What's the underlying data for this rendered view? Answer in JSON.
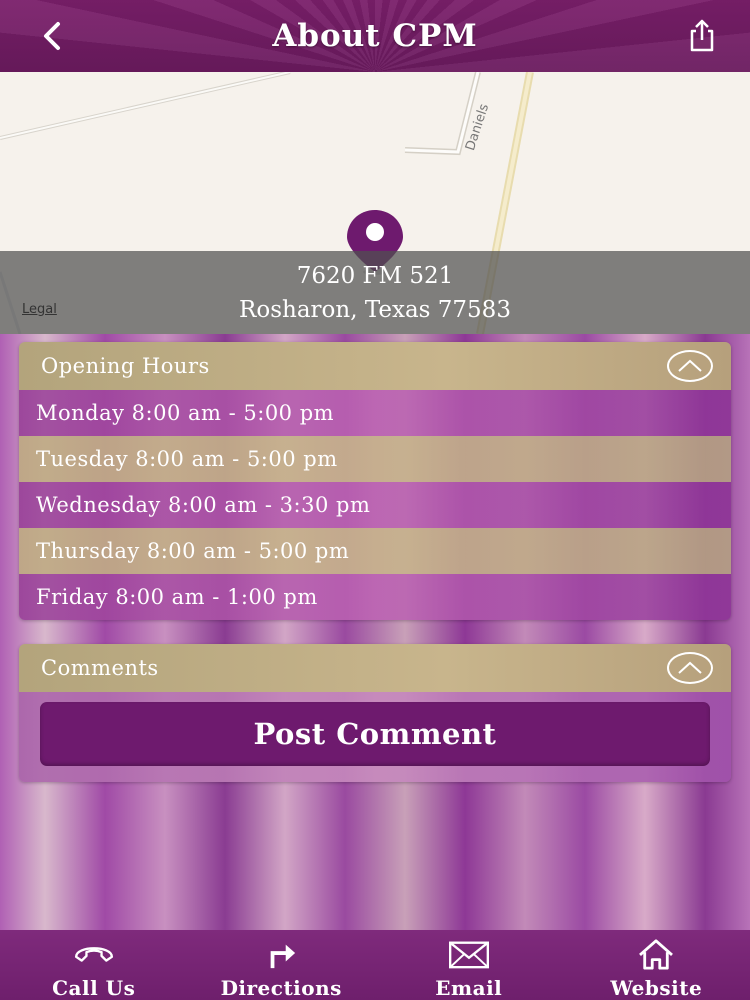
{
  "header": {
    "title": "About CPM",
    "back_icon": "chevron-left-icon",
    "share_icon": "share-icon"
  },
  "map": {
    "road_label": "Daniels",
    "legal_label": "Legal",
    "pin_icon": "map-pin-icon",
    "pin_color": "#6e1a6e"
  },
  "address": {
    "line1": "7620 FM 521",
    "line2": "Rosharon, Texas 77583"
  },
  "opening_hours": {
    "title": "Opening Hours",
    "rows": [
      {
        "label": "Monday 8:00 am - 5:00 pm"
      },
      {
        "label": "Tuesday 8:00 am - 5:00 pm"
      },
      {
        "label": "Wednesday 8:00 am - 3:30 pm"
      },
      {
        "label": "Thursday 8:00 am - 5:00 pm"
      },
      {
        "label": "Friday 8:00 am - 1:00 pm"
      }
    ]
  },
  "comments": {
    "title": "Comments",
    "post_label": "Post Comment"
  },
  "tabbar": {
    "items": [
      {
        "label": "Call Us",
        "icon": "phone-icon"
      },
      {
        "label": "Directions",
        "icon": "turn-right-arrow-icon"
      },
      {
        "label": "Email",
        "icon": "envelope-icon"
      },
      {
        "label": "Website",
        "icon": "home-icon"
      }
    ]
  },
  "colors": {
    "header": "#6a1a5e",
    "button": "#6e1a6e",
    "gold": "#c8b58c"
  }
}
